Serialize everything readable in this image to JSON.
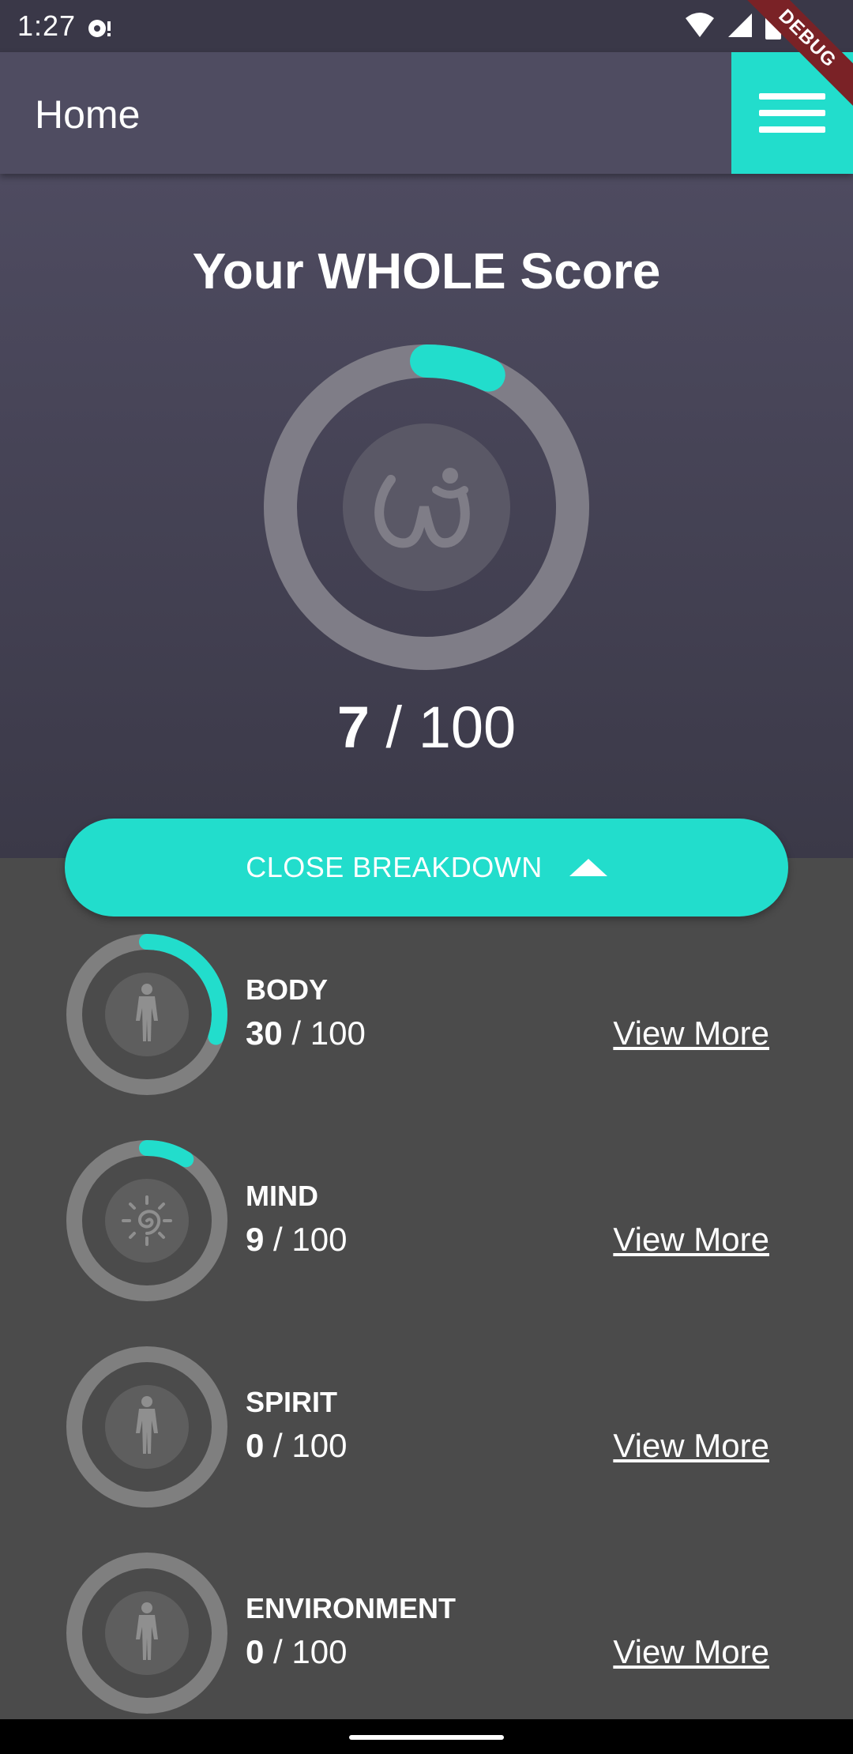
{
  "status_bar": {
    "time": "1:27"
  },
  "debug_banner": "DEBUG",
  "app_bar": {
    "title": "Home"
  },
  "colors": {
    "accent": "#22ddcc",
    "ring_track": "#7f7d87",
    "header": "#4f4c61",
    "background": "#4b4b4b"
  },
  "hero": {
    "title": "Your WHOLE Score",
    "score": "7",
    "separator": " / ",
    "max": "100",
    "progress": 0.07,
    "logo_icon": "whole-logo-icon"
  },
  "breakdown_button": {
    "label": "CLOSE BREAKDOWN",
    "icon": "caret-up-icon"
  },
  "categories": [
    {
      "name": "BODY",
      "score": "30",
      "max": "100",
      "progress": 0.3,
      "icon": "human-figure-icon",
      "link": "View More"
    },
    {
      "name": "MIND",
      "score": "9",
      "max": "100",
      "progress": 0.09,
      "icon": "spiral-sun-icon",
      "link": "View More"
    },
    {
      "name": "SPIRIT",
      "score": "0",
      "max": "100",
      "progress": 0.0,
      "icon": "human-figure-icon",
      "link": "View More"
    },
    {
      "name": "ENVIRONMENT",
      "score": "0",
      "max": "100",
      "progress": 0.0,
      "icon": "human-figure-icon",
      "link": "View More"
    }
  ]
}
